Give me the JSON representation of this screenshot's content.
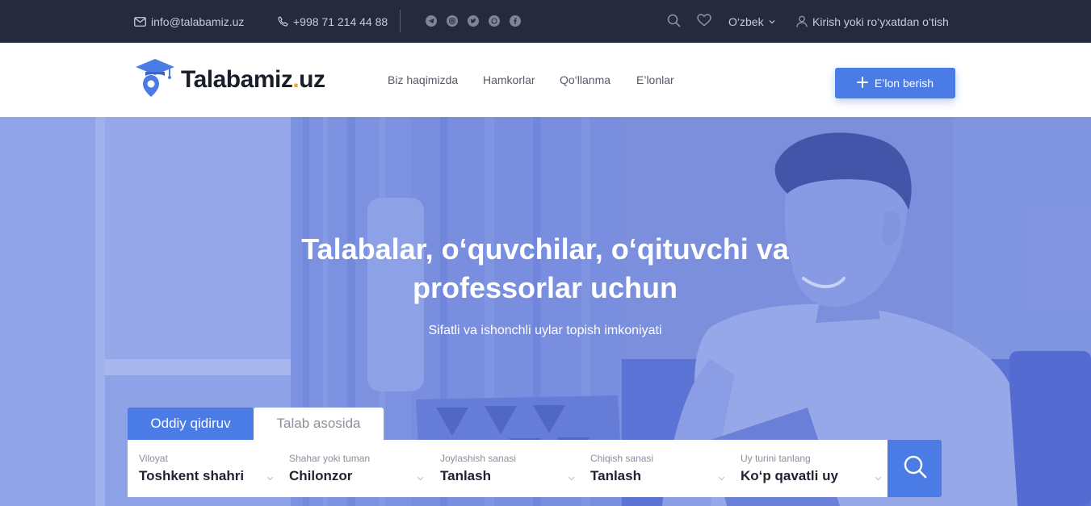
{
  "topbar": {
    "email": "info@talabamiz.uz",
    "phone": "+998 71 214 44 88",
    "social_icons": [
      "telegram-icon",
      "instagram-icon",
      "twitter-icon",
      "whatsapp-icon",
      "facebook-icon"
    ],
    "language": "O‘zbek",
    "login": "Kirish yoki ro‘yxatdan o‘tish"
  },
  "header": {
    "logo_text": "Talabamiz",
    "logo_dot": ".",
    "logo_suffix": "uz",
    "nav": [
      "Biz haqimizda",
      "Hamkorlar",
      "Qo‘llanma",
      "E’lonlar"
    ],
    "cta_label": "E’lon berish"
  },
  "hero": {
    "title_line1": "Talabalar, o‘quvchilar, o‘qituvchi va",
    "title_line2": "professorlar uchun",
    "subtitle": "Sifatli va ishonchli uylar topish imkoniyati"
  },
  "search": {
    "tabs": [
      "Oddiy qidiruv",
      "Talab asosida"
    ],
    "active_tab": "Oddiy qidiruv",
    "fields": [
      {
        "label": "Viloyat",
        "value": "Toshkent shahri"
      },
      {
        "label": "Shahar yoki tuman",
        "value": "Chilonzor"
      },
      {
        "label": "Joylashish sanasi",
        "value": "Tanlash"
      },
      {
        "label": "Chiqish sanasi",
        "value": "Tanlash"
      },
      {
        "label": "Uy turini tanlang",
        "value": "Ko‘p qavatli uy"
      }
    ]
  },
  "colors": {
    "topbar_bg": "#262a3d",
    "accent": "#4b7be5",
    "logo_dot": "#f5a623",
    "hero_tint": "#8ea3e6"
  }
}
